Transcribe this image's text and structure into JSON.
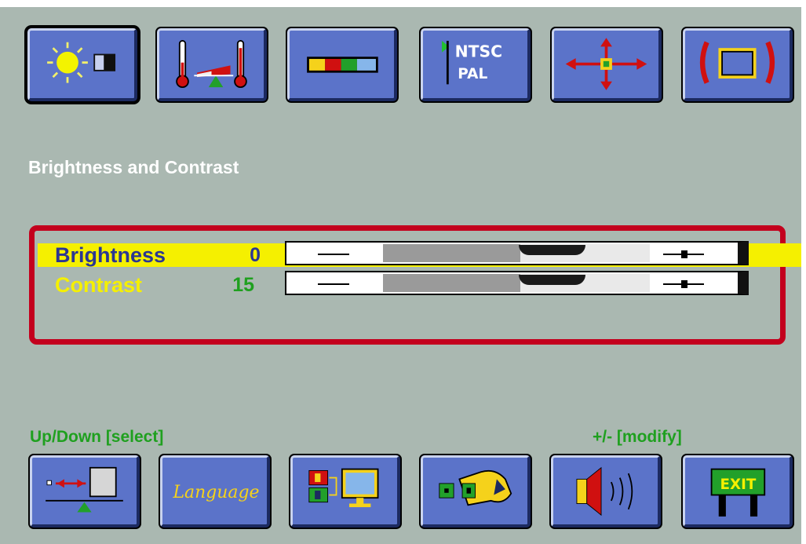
{
  "screen": {
    "title": "Brightness and Contrast",
    "top_menu": [
      {
        "name": "brightness-contrast-icon",
        "selected": true
      },
      {
        "name": "color-temperature-icon",
        "selected": false
      },
      {
        "name": "color-bars-icon",
        "selected": false
      },
      {
        "name": "ntsc-pal-icon",
        "selected": false,
        "text_line1": "NTSC",
        "text_line2": "PAL"
      },
      {
        "name": "position-icon",
        "selected": false
      },
      {
        "name": "size-icon",
        "selected": false
      }
    ],
    "settings": [
      {
        "label": "Brightness",
        "value": "0",
        "selected": true
      },
      {
        "label": "Contrast",
        "value": "15",
        "selected": false
      }
    ],
    "hints": {
      "left": "Up/Down [select]",
      "right": "+/- [modify]"
    },
    "bottom_menu": [
      {
        "name": "balance-icon"
      },
      {
        "name": "language-icon",
        "text": "Language"
      },
      {
        "name": "input-select-icon"
      },
      {
        "name": "tools-icon"
      },
      {
        "name": "volume-icon"
      },
      {
        "name": "exit-icon",
        "text": "EXIT"
      }
    ]
  },
  "colors": {
    "background": "#aab8b1",
    "button": "#5b73c9",
    "panel_border": "#c3001d",
    "selected_row": "#f5f000",
    "label_selected": "#2b3693",
    "label_normal": "#f5f000",
    "value_selected": "#2b3693",
    "value_normal": "#1fa01f",
    "hint": "#1fa01f"
  }
}
